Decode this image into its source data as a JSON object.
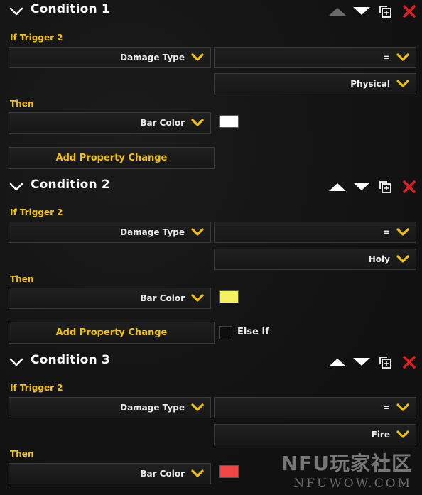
{
  "colors": {
    "accent": "#f3c200",
    "close": "#e02020",
    "up_disabled": "#6a6a6a",
    "up_enabled": "#ffffff"
  },
  "icons": {
    "collapse": "chevron-down-icon",
    "up": "triangle-up-icon",
    "down": "triangle-down-icon",
    "duplicate": "duplicate-icon",
    "delete": "close-icon",
    "dropdown": "chevron-down-icon"
  },
  "conditions": [
    {
      "title": "Condition 1",
      "if_label": "If Trigger 2",
      "property": "Damage Type",
      "operator": "=",
      "value": "Physical",
      "then_label": "Then",
      "change_property": "Bar Color",
      "color": "#ffffff",
      "add_label": "Add Property Change",
      "up_enabled": false
    },
    {
      "title": "Condition 2",
      "if_label": "If Trigger 2",
      "property": "Damage Type",
      "operator": "=",
      "value": "Holy",
      "then_label": "Then",
      "change_property": "Bar Color",
      "color": "#f5f060",
      "add_label": "Add Property Change",
      "else_if_label": "Else If",
      "up_enabled": true
    },
    {
      "title": "Condition 3",
      "if_label": "If Trigger 2",
      "property": "Damage Type",
      "operator": "=",
      "value": "Fire",
      "then_label": "Then",
      "change_property": "Bar Color",
      "color": "#f04545",
      "up_enabled": true
    }
  ],
  "watermark": {
    "top": "NFU玩家社区",
    "bottom": "NFUWOW.COM"
  }
}
